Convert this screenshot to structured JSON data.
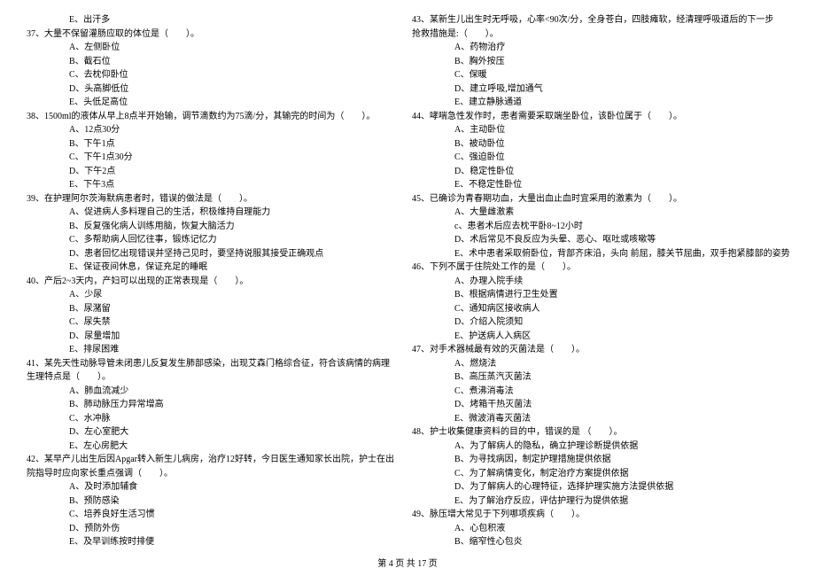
{
  "footer": "第 4 页 共 17 页",
  "left_column": [
    {
      "type": "option",
      "text": "E、出汗多"
    },
    {
      "type": "question",
      "text": "37、大量不保留灌肠应取的体位是（　　）。"
    },
    {
      "type": "option",
      "text": "A、左侧卧位"
    },
    {
      "type": "option",
      "text": "B、截石位"
    },
    {
      "type": "option",
      "text": "C、去枕仰卧位"
    },
    {
      "type": "option",
      "text": "D、头高脚低位"
    },
    {
      "type": "option",
      "text": "E、头低足高位"
    },
    {
      "type": "question",
      "text": "38、1500ml的液体从早上8点半开始输，调节滴数约为75滴/分，其输完的时间为（　　）。"
    },
    {
      "type": "option",
      "text": "A、12点30分"
    },
    {
      "type": "option",
      "text": "B、下午1点"
    },
    {
      "type": "option",
      "text": "C、下午1点30分"
    },
    {
      "type": "option",
      "text": "D、下午2点"
    },
    {
      "type": "option",
      "text": "E、下午3点"
    },
    {
      "type": "question",
      "text": "39、在护理阿尔茨海默病患者时，错误的做法是（　　）。"
    },
    {
      "type": "option",
      "text": "A、促进病人多料理自己的生活，积极维持自理能力"
    },
    {
      "type": "option",
      "text": "B、反复强化病人训练用脑，恢复大脑活力"
    },
    {
      "type": "option",
      "text": "C、多帮助病人回忆往事，锻炼记忆力"
    },
    {
      "type": "option",
      "text": "D、患者回忆出现错误并坚持己见时，要坚持说服其接受正确观点"
    },
    {
      "type": "option",
      "text": "E、保证夜间休息，保证充足的睡眠"
    },
    {
      "type": "question",
      "text": "40、产后2~3天内，产妇可以出现的正常表现是（　　）。"
    },
    {
      "type": "option",
      "text": "A、少尿"
    },
    {
      "type": "option",
      "text": "B、尿潴留"
    },
    {
      "type": "option",
      "text": "C、尿失禁"
    },
    {
      "type": "option",
      "text": "D、尿量增加"
    },
    {
      "type": "option",
      "text": "E、排尿困难"
    },
    {
      "type": "question",
      "text": "41、某先天性动脉导管未闭患儿反复发生肺部感染，出现艾森门格综合征，符合该病情的病理"
    },
    {
      "type": "continuation",
      "text": "生理特点是（　　）。"
    },
    {
      "type": "option",
      "text": "A、肺血流减少"
    },
    {
      "type": "option",
      "text": "B、肺动脉压力异常增高"
    },
    {
      "type": "option",
      "text": "C、水冲脉"
    },
    {
      "type": "option",
      "text": "D、左心室肥大"
    },
    {
      "type": "option",
      "text": "E、左心房肥大"
    },
    {
      "type": "question",
      "text": "42、某早产儿出生后因Apgar转入新生儿病房，治疗12好转，今日医生通知家长出院，护士在出"
    },
    {
      "type": "continuation",
      "text": "院指导时应向家长重点强调（　　）。"
    },
    {
      "type": "option",
      "text": "A、及时添加辅食"
    },
    {
      "type": "option",
      "text": "B、预防感染"
    },
    {
      "type": "option",
      "text": "C、培养良好生活习惯"
    },
    {
      "type": "option",
      "text": "D、预防外伤"
    },
    {
      "type": "option",
      "text": "E、及早训练按时排便"
    }
  ],
  "right_column": [
    {
      "type": "question",
      "text": "43、某新生儿出生时无呼吸，心率<90次/分，全身苍白，四肢瘫软，经清理呼吸道后的下一步"
    },
    {
      "type": "continuation",
      "text": "抢救措施是:（　　）。"
    },
    {
      "type": "option",
      "text": "A、药物治疗"
    },
    {
      "type": "option",
      "text": "B、胸外按压"
    },
    {
      "type": "option",
      "text": "C、保暖"
    },
    {
      "type": "option",
      "text": "D、建立呼吸,增加通气"
    },
    {
      "type": "option",
      "text": "E、建立静脉通道"
    },
    {
      "type": "question",
      "text": "44、哮喘急性发作时，患者需要采取端坐卧位，该卧位属于（　　）。"
    },
    {
      "type": "option",
      "text": "A、主动卧位"
    },
    {
      "type": "option",
      "text": "B、被动卧位"
    },
    {
      "type": "option",
      "text": "C、强迫卧位"
    },
    {
      "type": "option",
      "text": "D、稳定性卧位"
    },
    {
      "type": "option",
      "text": "E、不稳定性卧位"
    },
    {
      "type": "question",
      "text": "45、已确诊为青春期功血，大量出血止血时宜采用的激素为（　　）。"
    },
    {
      "type": "option",
      "text": "A、大量雌激素"
    },
    {
      "type": "option",
      "text": "c、患者术后应去枕平卧8~12小时"
    },
    {
      "type": "option",
      "text": "D、术后常见不良反应为头晕、恶心、呕吐或咳嗽等"
    },
    {
      "type": "option",
      "text": "E、术中患者采取俯卧位，背部齐床沿，头向 前屈，膝关节屈曲，双手抱紧膝部的姿势"
    },
    {
      "type": "question",
      "text": "46、下列不属于住院处工作的是（　　）。"
    },
    {
      "type": "option",
      "text": "A、办理入院手续"
    },
    {
      "type": "option",
      "text": "B、根据病情进行卫生处置"
    },
    {
      "type": "option",
      "text": "C、通知病区接收病人"
    },
    {
      "type": "option",
      "text": "D、介绍入院须知"
    },
    {
      "type": "option",
      "text": "E、护送病人入病区"
    },
    {
      "type": "question",
      "text": "47、对手术器械最有效的灭菌法是（　　）。"
    },
    {
      "type": "option",
      "text": "A、燃烧法"
    },
    {
      "type": "option",
      "text": "B、高压蒸汽灭菌法"
    },
    {
      "type": "option",
      "text": "C、煮沸消毒法"
    },
    {
      "type": "option",
      "text": "D、烤箱干热灭菌法"
    },
    {
      "type": "option",
      "text": "E、微波消毒灭菌法"
    },
    {
      "type": "question",
      "text": "48、护士收集健康资料的目的中，错误的是 （　　）。"
    },
    {
      "type": "option",
      "text": "A、为了解病人的隐私，确立护理诊断提供依据"
    },
    {
      "type": "option",
      "text": "B、为寻找病因，制定护理措施提供依据"
    },
    {
      "type": "option",
      "text": "C、为了解病情变化，制定治疗方案提供依据"
    },
    {
      "type": "option",
      "text": "D、为了解病人的心理特征，选择护理实施方法提供依据"
    },
    {
      "type": "option",
      "text": "E、为了解治疗反应，评估护理行为提供依据"
    },
    {
      "type": "question",
      "text": "49、脉压增大常见于下列哪项疾病（　　）。"
    },
    {
      "type": "option",
      "text": "A、心包积液"
    },
    {
      "type": "option",
      "text": "B、缩窄性心包炎"
    }
  ]
}
